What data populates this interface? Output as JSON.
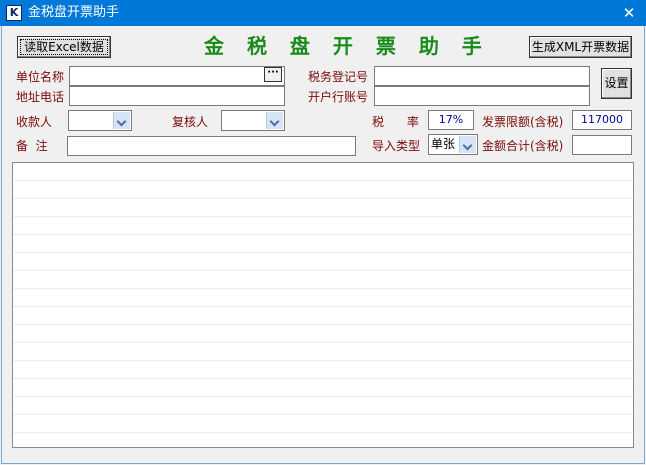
{
  "window": {
    "title": "金税盘开票助手",
    "icon": "K",
    "close_glyph": "✕"
  },
  "toolbar": {
    "read_excel_label": "读取Excel数据",
    "heading": "金 税 盘 开 票 助 手",
    "generate_xml_label": "生成XML开票数据",
    "settings_label": "设置"
  },
  "form": {
    "company_name_label": "单位名称",
    "company_name_value": "",
    "browse_label": "···",
    "address_phone_label": "地址电话",
    "address_phone_value": "",
    "tax_reg_label": "税务登记号",
    "tax_reg_value": "",
    "bank_account_label": "开户行账号",
    "bank_account_value": "",
    "payee_label": "收款人",
    "payee_value": "",
    "reviewer_label": "复核人",
    "reviewer_value": "",
    "tax_rate_label": "税      率",
    "tax_rate_value": "17%",
    "invoice_limit_label": "发票限额(含税)",
    "invoice_limit_value": "117000",
    "notes_label": "备  注",
    "notes_value": "",
    "import_type_label": "导入类型",
    "import_type_value": "单张",
    "total_amount_label": "金额合计(含税)",
    "total_amount_value": ""
  },
  "colors": {
    "titlebar": "#0078d7",
    "label": "#7a0a0a",
    "heading": "#1a8a1a",
    "value": "#00009a"
  }
}
